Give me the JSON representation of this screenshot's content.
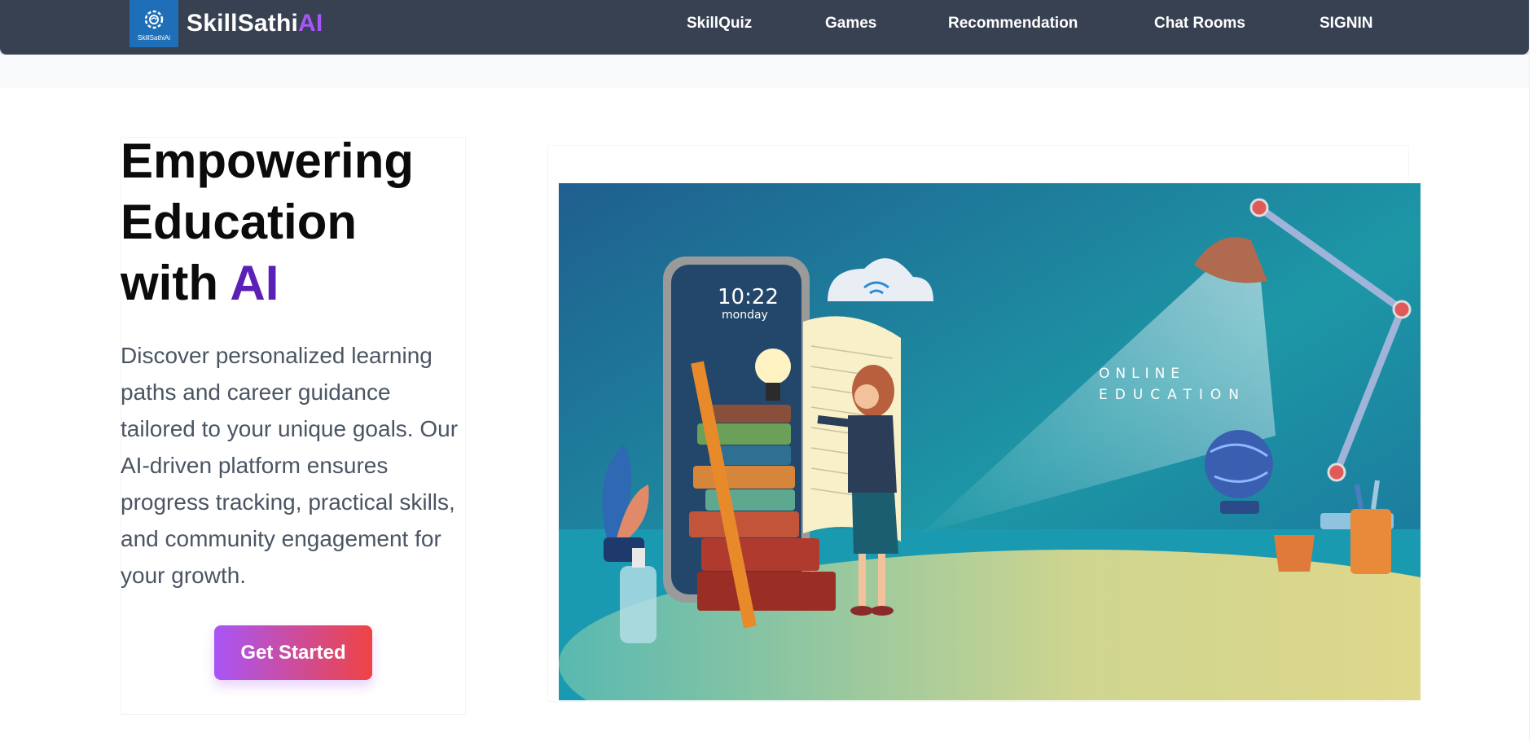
{
  "navbar": {
    "logo_caption": "SkillSathiAi",
    "brand_main": "SkillSathi",
    "brand_accent": "AI",
    "links": [
      "SkillQuiz",
      "Games",
      "Recommendation",
      "Chat Rooms",
      "SIGNIN"
    ]
  },
  "hero": {
    "title_line1": "Empowering",
    "title_line2": "Education",
    "title_line3_prefix": "with ",
    "title_line3_accent": "AI",
    "description": "Discover personalized learning paths and career guidance tailored to your unique goals. Our AI-driven platform ensures progress tracking, practical skills, and community engagement for your growth.",
    "cta_label": "Get Started"
  },
  "illustration": {
    "phone_time": "10:22",
    "phone_day": "monday",
    "caption_line1": "ONLINE",
    "caption_line2": "EDUCATION"
  },
  "colors": {
    "navbar_bg": "#374151",
    "brand_accent": "#a855f7",
    "title_accent": "#5b21b6",
    "cta_gradient_start": "#a855f7",
    "cta_gradient_end": "#ef4444"
  }
}
